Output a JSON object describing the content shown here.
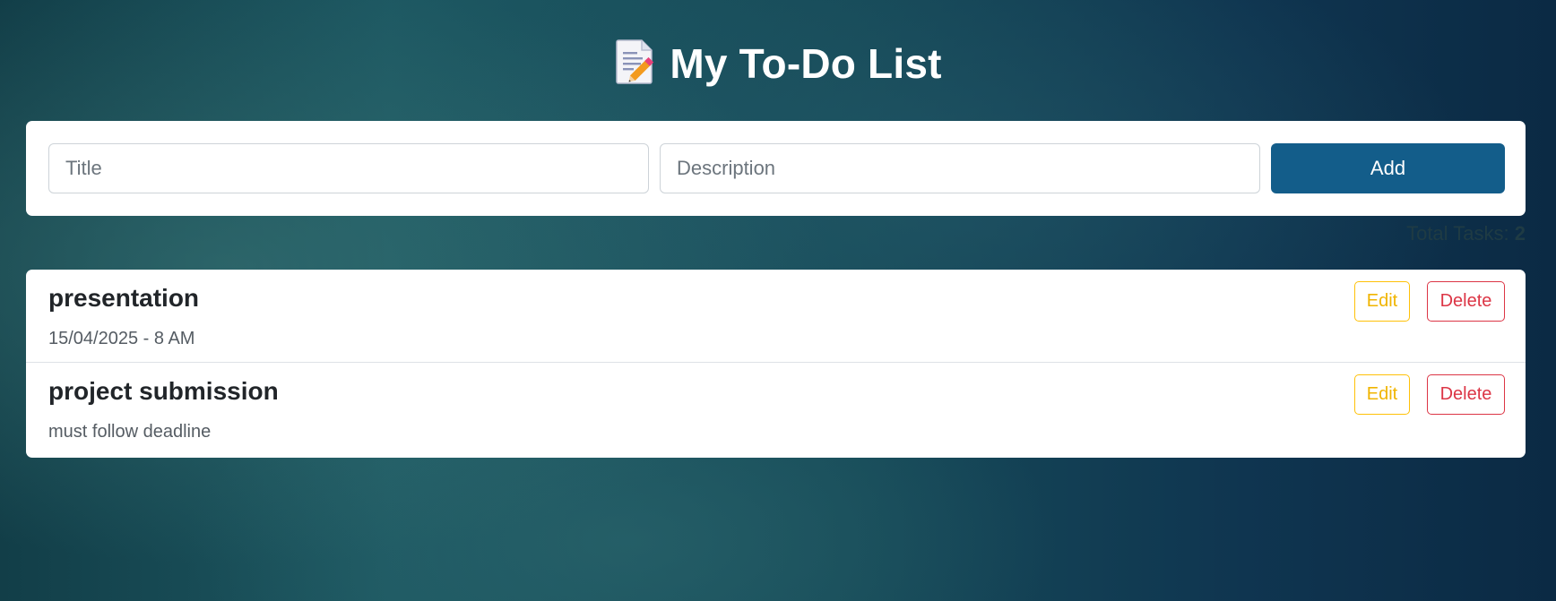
{
  "header": {
    "title": "My To-Do List",
    "icon": "memo-icon"
  },
  "form": {
    "title_placeholder": "Title",
    "description_placeholder": "Description",
    "add_label": "Add"
  },
  "summary": {
    "label": "Total Tasks:",
    "count": "2"
  },
  "tasks": [
    {
      "title": "presentation",
      "description": "15/04/2025 - 8 AM",
      "edit_label": "Edit",
      "delete_label": "Delete"
    },
    {
      "title": "project submission",
      "description": "must follow deadline",
      "edit_label": "Edit",
      "delete_label": "Delete"
    }
  ],
  "colors": {
    "primary": "#135d8a",
    "edit": "#ffc107",
    "delete": "#dc3545"
  }
}
